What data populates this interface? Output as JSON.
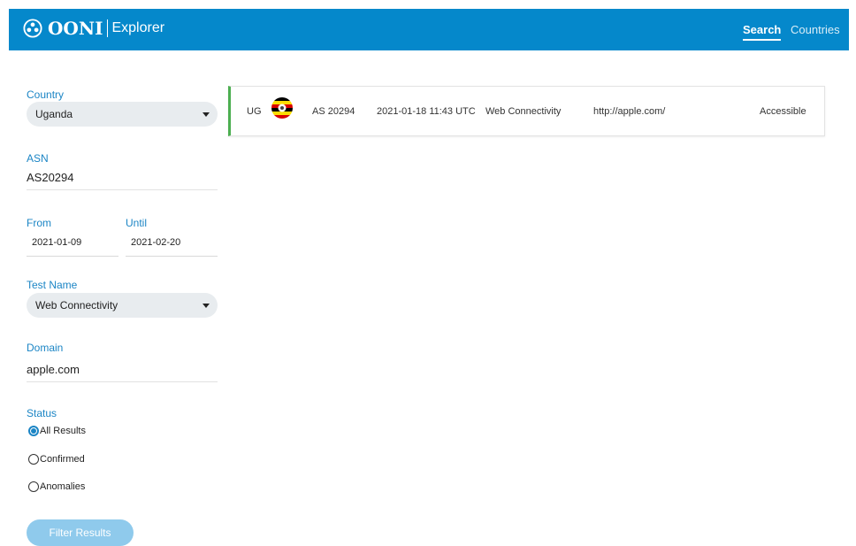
{
  "navbar": {
    "brand": "OONI",
    "product": "Explorer",
    "links": [
      "Search",
      "Countries"
    ]
  },
  "sidebar": {
    "country": {
      "label": "Country",
      "value": "Uganda"
    },
    "asn": {
      "label": "ASN",
      "value": "AS20294"
    },
    "from": {
      "label": "From",
      "value": "2021-01-09"
    },
    "until": {
      "label": "Until",
      "value": "2021-02-20"
    },
    "test_name": {
      "label": "Test Name",
      "value": "Web Connectivity"
    },
    "domain": {
      "label": "Domain",
      "value": "apple.com"
    },
    "status": {
      "label": "Status",
      "options": [
        "All Results",
        "Confirmed",
        "Anomalies"
      ],
      "selected": "All Results"
    },
    "filter_button": "Filter Results"
  },
  "results": [
    {
      "country_code": "UG",
      "flag_icon": "uganda-flag-icon",
      "asn": "AS 20294",
      "date": "2021-01-18 11:43 UTC",
      "test_name": "Web Connectivity",
      "url": "http://apple.com/",
      "status": "Accessible",
      "status_color": "#4caf50"
    }
  ],
  "colors": {
    "brand_blue": "#0588cb",
    "label_blue": "#1b85c5",
    "button_blue": "#8fcaec",
    "select_bg": "#e8ecef"
  }
}
